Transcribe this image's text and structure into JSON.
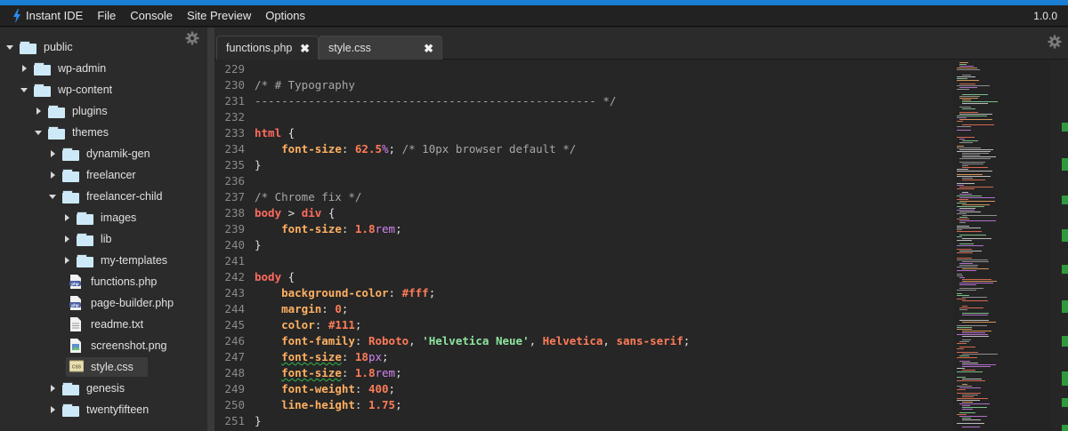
{
  "app": {
    "name": "Instant IDE",
    "version": "1.0.0",
    "menu": [
      "File",
      "Console",
      "Site Preview",
      "Options"
    ]
  },
  "sidebar": {
    "gear_icon": "gear-icon",
    "tree": [
      {
        "label": "public",
        "type": "folder",
        "expanded": true
      },
      {
        "label": "wp-admin",
        "type": "folder",
        "expanded": false
      },
      {
        "label": "wp-content",
        "type": "folder",
        "expanded": true
      },
      {
        "label": "plugins",
        "type": "folder",
        "expanded": false
      },
      {
        "label": "themes",
        "type": "folder",
        "expanded": true
      },
      {
        "label": "dynamik-gen",
        "type": "folder",
        "expanded": false
      },
      {
        "label": "freelancer",
        "type": "folder",
        "expanded": false
      },
      {
        "label": "freelancer-child",
        "type": "folder",
        "expanded": true
      },
      {
        "label": "images",
        "type": "folder",
        "expanded": false
      },
      {
        "label": "lib",
        "type": "folder",
        "expanded": false
      },
      {
        "label": "my-templates",
        "type": "folder",
        "expanded": false
      },
      {
        "label": "functions.php",
        "type": "php"
      },
      {
        "label": "page-builder.php",
        "type": "php"
      },
      {
        "label": "readme.txt",
        "type": "txt"
      },
      {
        "label": "screenshot.png",
        "type": "png"
      },
      {
        "label": "style.css",
        "type": "css",
        "selected": true
      },
      {
        "label": "genesis",
        "type": "folder",
        "expanded": false
      },
      {
        "label": "twentyfifteen",
        "type": "folder",
        "expanded": false
      }
    ]
  },
  "editor": {
    "tabs": [
      {
        "label": "functions.php",
        "close": "✖",
        "active": false
      },
      {
        "label": "style.css",
        "close": "✖",
        "active": true
      }
    ],
    "lines": [
      {
        "n": "229",
        "t": ""
      },
      {
        "n": "230",
        "t": "/* # Typography"
      },
      {
        "n": "231",
        "t": "--------------------------------------------------- */"
      },
      {
        "n": "232",
        "t": ""
      },
      {
        "n": "233",
        "t": "html {"
      },
      {
        "n": "234",
        "t": "    font-size: 62.5%; /* 10px browser default */"
      },
      {
        "n": "235",
        "t": "}"
      },
      {
        "n": "236",
        "t": ""
      },
      {
        "n": "237",
        "t": "/* Chrome fix */"
      },
      {
        "n": "238",
        "t": "body > div {"
      },
      {
        "n": "239",
        "t": "    font-size: 1.8rem;"
      },
      {
        "n": "240",
        "t": "}"
      },
      {
        "n": "241",
        "t": ""
      },
      {
        "n": "242",
        "t": "body {"
      },
      {
        "n": "243",
        "t": "    background-color: #fff;"
      },
      {
        "n": "244",
        "t": "    margin: 0;"
      },
      {
        "n": "245",
        "t": "    color: #111;"
      },
      {
        "n": "246",
        "t": "    font-family: Roboto, 'Helvetica Neue', Helvetica, sans-serif;"
      },
      {
        "n": "247",
        "t": "    font-size: 18px;"
      },
      {
        "n": "248",
        "t": "    font-size: 1.8rem;"
      },
      {
        "n": "249",
        "t": "    font-weight: 400;"
      },
      {
        "n": "250",
        "t": "    line-height: 1.75;"
      },
      {
        "n": "251",
        "t": "}"
      }
    ]
  },
  "colors": {
    "accent": "#1a7fd4",
    "selector": "#ff6a5e",
    "property": "#ffb062",
    "value": "#ff7b58",
    "unit": "#d383f2",
    "string": "#8ee3a0",
    "folder": "#cde9f7"
  }
}
